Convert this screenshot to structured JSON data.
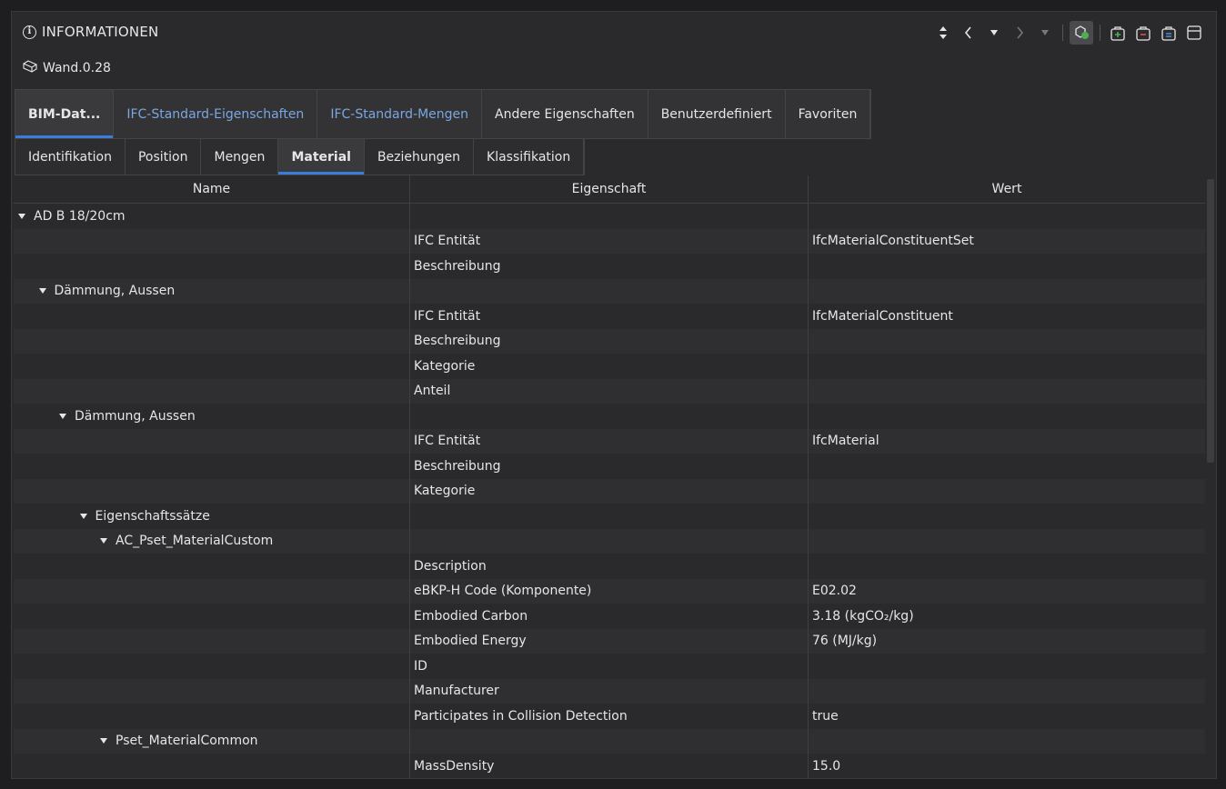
{
  "window": {
    "title": "INFORMATIONEN"
  },
  "element": {
    "name": "Wand.0.28"
  },
  "tabs_primary": [
    {
      "label": "BIM-Dat...",
      "active": true,
      "link": false
    },
    {
      "label": "IFC-Standard-Eigenschaften",
      "active": false,
      "link": true
    },
    {
      "label": "IFC-Standard-Mengen",
      "active": false,
      "link": true
    },
    {
      "label": "Andere Eigenschaften",
      "active": false,
      "link": false
    },
    {
      "label": "Benutzerdefiniert",
      "active": false,
      "link": false
    },
    {
      "label": "Favoriten",
      "active": false,
      "link": false
    }
  ],
  "tabs_secondary": [
    {
      "label": "Identifikation",
      "active": false
    },
    {
      "label": "Position",
      "active": false
    },
    {
      "label": "Mengen",
      "active": false
    },
    {
      "label": "Material",
      "active": true
    },
    {
      "label": "Beziehungen",
      "active": false
    },
    {
      "label": "Klassifikation",
      "active": false
    }
  ],
  "table": {
    "headers": [
      "Name",
      "Eigenschaft",
      "Wert"
    ],
    "rows": [
      {
        "name": "AD B 18/20cm",
        "level": 0,
        "expandable": true,
        "prop": "",
        "value": ""
      },
      {
        "name": "",
        "level": 0,
        "expandable": false,
        "prop": "IFC Entität",
        "value": "IfcMaterialConstituentSet"
      },
      {
        "name": "",
        "level": 0,
        "expandable": false,
        "prop": "Beschreibung",
        "value": ""
      },
      {
        "name": "Dämmung, Aussen",
        "level": 1,
        "expandable": true,
        "prop": "",
        "value": ""
      },
      {
        "name": "",
        "level": 0,
        "expandable": false,
        "prop": "IFC Entität",
        "value": "IfcMaterialConstituent"
      },
      {
        "name": "",
        "level": 0,
        "expandable": false,
        "prop": "Beschreibung",
        "value": ""
      },
      {
        "name": "",
        "level": 0,
        "expandable": false,
        "prop": "Kategorie",
        "value": ""
      },
      {
        "name": "",
        "level": 0,
        "expandable": false,
        "prop": "Anteil",
        "value": ""
      },
      {
        "name": "Dämmung, Aussen",
        "level": 2,
        "expandable": true,
        "prop": "",
        "value": ""
      },
      {
        "name": "",
        "level": 0,
        "expandable": false,
        "prop": "IFC Entität",
        "value": "IfcMaterial"
      },
      {
        "name": "",
        "level": 0,
        "expandable": false,
        "prop": "Beschreibung",
        "value": ""
      },
      {
        "name": "",
        "level": 0,
        "expandable": false,
        "prop": "Kategorie",
        "value": ""
      },
      {
        "name": "Eigenschaftssätze",
        "level": 3,
        "expandable": true,
        "prop": "",
        "value": ""
      },
      {
        "name": "AC_Pset_MaterialCustom",
        "level": 4,
        "expandable": true,
        "prop": "",
        "value": ""
      },
      {
        "name": "",
        "level": 0,
        "expandable": false,
        "prop": "Description",
        "value": ""
      },
      {
        "name": "",
        "level": 0,
        "expandable": false,
        "prop": "eBKP-H Code (Komponente)",
        "value": "E02.02"
      },
      {
        "name": "",
        "level": 0,
        "expandable": false,
        "prop": "Embodied Carbon",
        "value": "3.18 (kgCO₂/kg)"
      },
      {
        "name": "",
        "level": 0,
        "expandable": false,
        "prop": "Embodied Energy",
        "value": "76 (MJ/kg)"
      },
      {
        "name": "",
        "level": 0,
        "expandable": false,
        "prop": "ID",
        "value": ""
      },
      {
        "name": "",
        "level": 0,
        "expandable": false,
        "prop": "Manufacturer",
        "value": ""
      },
      {
        "name": "",
        "level": 0,
        "expandable": false,
        "prop": "Participates in Collision Detection",
        "value": "true"
      },
      {
        "name": "Pset_MaterialCommon",
        "level": 4,
        "expandable": true,
        "prop": "",
        "value": ""
      },
      {
        "name": "",
        "level": 0,
        "expandable": false,
        "prop": "MassDensity",
        "value": "15.0"
      }
    ]
  },
  "colors": {
    "accent": "#3b7ddd",
    "link": "#7aa7e0",
    "background": "#2a2a2c"
  },
  "icons": {
    "info": "info-icon",
    "element": "wall-icon",
    "toolbar": [
      "sort-icon",
      "back-icon",
      "history-dropdown-icon",
      "forward-icon",
      "forward-dropdown-icon",
      "selection-filter-icon",
      "favorite-add-icon",
      "favorite-remove-icon",
      "favorite-manage-icon",
      "panel-layout-icon"
    ]
  }
}
